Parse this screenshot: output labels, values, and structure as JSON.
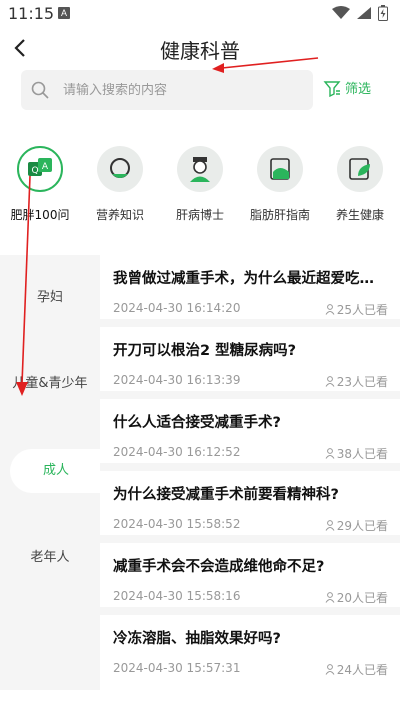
{
  "status_bar": {
    "time": "11:15",
    "notification_icon": "A"
  },
  "header": {
    "title": "健康科普"
  },
  "search": {
    "placeholder": "请输入搜索的内容"
  },
  "filter": {
    "label": "筛选"
  },
  "categories": [
    {
      "label": "肥胖100问",
      "icon": "obesity-icon",
      "active": true
    },
    {
      "label": "营养知识",
      "icon": "nutrition-icon",
      "active": false
    },
    {
      "label": "肝病博士",
      "icon": "doctor-icon",
      "active": false
    },
    {
      "label": "脂肪肝指南",
      "icon": "liver-guide-icon",
      "active": false
    },
    {
      "label": "养生健康",
      "icon": "wellness-icon",
      "active": false
    }
  ],
  "sidebar": [
    {
      "label": "孕妇",
      "active": false
    },
    {
      "label": "儿童&青少年",
      "active": false
    },
    {
      "label": "成人",
      "active": true
    },
    {
      "label": "老年人",
      "active": false
    }
  ],
  "articles": [
    {
      "title": "我曾做过减重手术，为什么最近超爱吃甜食？",
      "date": "2024-04-30 16:14:20",
      "views": "25人已看"
    },
    {
      "title": "开刀可以根治2 型糖尿病吗?",
      "date": "2024-04-30 16:13:39",
      "views": "23人已看"
    },
    {
      "title": "什么人适合接受减重手术?",
      "date": "2024-04-30 16:12:52",
      "views": "38人已看"
    },
    {
      "title": "为什么接受减重手术前要看精神科?",
      "date": "2024-04-30 15:58:52",
      "views": "29人已看"
    },
    {
      "title": "减重手术会不会造成维他命不足?",
      "date": "2024-04-30 15:58:16",
      "views": "20人已看"
    },
    {
      "title": "冷冻溶脂、抽脂效果好吗?",
      "date": "2024-04-30 15:57:31",
      "views": "24人已看"
    }
  ],
  "colors": {
    "accent": "#2bb55c",
    "annotation_arrow": "#e02020"
  }
}
